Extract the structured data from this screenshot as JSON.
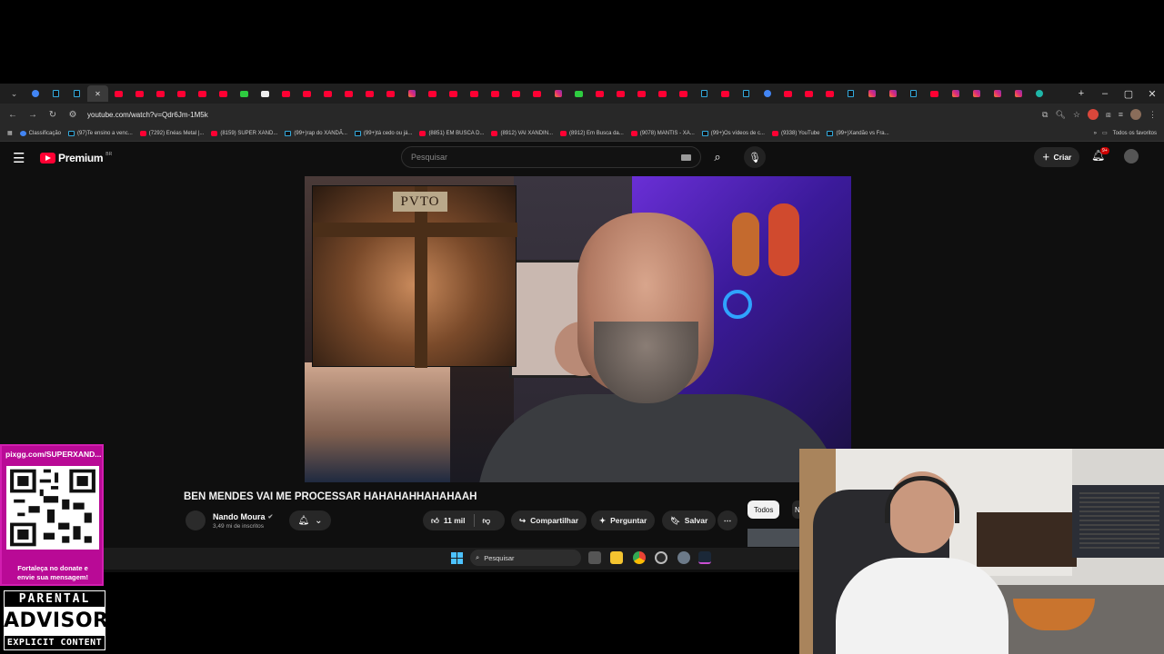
{
  "browser": {
    "url": "youtube.com/watch?v=Qdr6Jm-1M5k",
    "bookmarks": [
      {
        "label": "Classificação",
        "icon": "globe-icon"
      },
      {
        "label": "(97)Te ensino a venc...",
        "icon": "tiktok-icon"
      },
      {
        "label": "(7292) Enéas Metal |...",
        "icon": "youtube-icon"
      },
      {
        "label": "(8159) SUPER XAND...",
        "icon": "youtube-icon"
      },
      {
        "label": "(99+)rap do XANDÃ...",
        "icon": "tiktok-icon"
      },
      {
        "label": "(99+)tá cedo ou já...",
        "icon": "tiktok-icon"
      },
      {
        "label": "(8851) EM BUSCA D...",
        "icon": "youtube-icon"
      },
      {
        "label": "(8912) VAI XANDIN...",
        "icon": "youtube-icon"
      },
      {
        "label": "(8912) Em Busca da...",
        "icon": "youtube-icon"
      },
      {
        "label": "(9078) MANTIS - XA...",
        "icon": "youtube-icon"
      },
      {
        "label": "(99+)Os vídeos de c...",
        "icon": "tiktok-icon"
      },
      {
        "label": "(9338) YouTube",
        "icon": "youtube-icon"
      },
      {
        "label": "(99+)Xandão vs Fra...",
        "icon": "tiktok-icon"
      }
    ],
    "bookmarks_all": "Todos os favoritos",
    "tabs": [
      "chrome",
      "tt",
      "tt",
      "close",
      "yt",
      "yt",
      "yt",
      "yt",
      "yt",
      "yt",
      "gr",
      "wh",
      "yt",
      "yt",
      "yt",
      "yt",
      "yt",
      "yt",
      "ig",
      "yt",
      "yt",
      "yt",
      "yt",
      "yt",
      "yt",
      "ig",
      "gr",
      "yt",
      "yt",
      "yt",
      "yt",
      "yt",
      "tt",
      "yt",
      "tt",
      "bl",
      "yt",
      "yt",
      "yt",
      "tt",
      "ig",
      "ig",
      "tt",
      "yt",
      "ig",
      "ig",
      "ig",
      "ig",
      "cy"
    ]
  },
  "youtube": {
    "logo_text": "Premium",
    "logo_region": "BR",
    "search_placeholder": "Pesquisar",
    "create_label": "Criar",
    "notification_badge": "9+",
    "video_overlay_sign": "PVTO",
    "video_title": "BEN MENDES VAI ME PROCESSAR HAHAHAHHAHAHAAH",
    "channel_name": "Nando Moura",
    "subscribers": "3,49 mi de inscritos",
    "likes": "11 mil",
    "share_label": "Compartilhar",
    "ask_label": "Perguntar",
    "save_label": "Salvar",
    "chip_all": "Todos",
    "chip_next": "N"
  },
  "taskbar": {
    "search_placeholder": "Pesquisar"
  },
  "overlay": {
    "qr_url": "pixgg.com/SUPERXAND...",
    "qr_caption_1": "Fortaleça no donate e",
    "qr_caption_2": "envie sua mensagem!",
    "advisory_top": "PARENTAL",
    "advisory_mid": "ADVISORY",
    "advisory_bottom": "EXPLICIT CONTENT"
  },
  "colors": {
    "youtube_red": "#ff0033",
    "qr_magenta": "#b90a96",
    "page_bg": "#0f0f0f"
  }
}
